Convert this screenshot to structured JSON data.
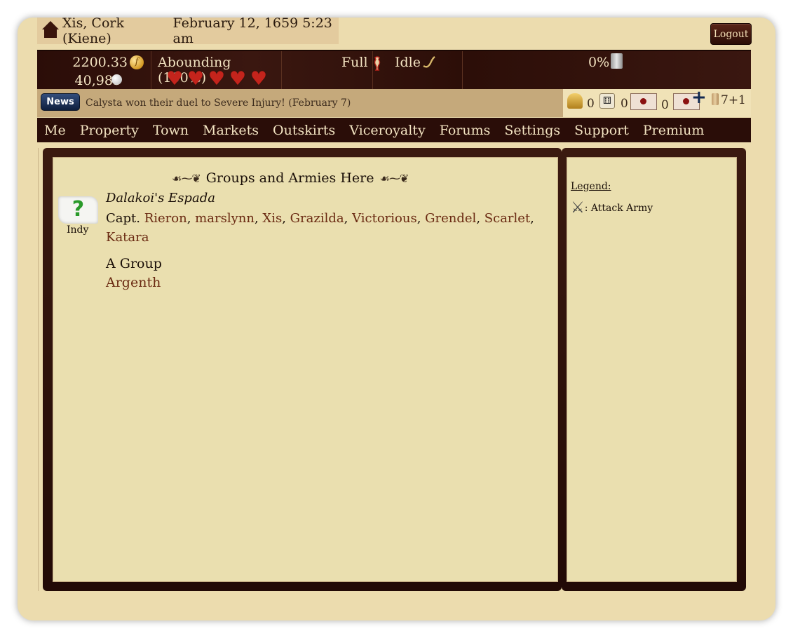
{
  "location": {
    "place": "Xis, Cork (Kiene)",
    "datetime": "February 12, 1659 5:23 am"
  },
  "logout_label": "Logout",
  "status": {
    "gold": "2200.33",
    "pearls": "40,985",
    "mood": "Abounding (100%)",
    "hearts": 5,
    "hunger": "Full",
    "activity": "Idle",
    "drink": "0%"
  },
  "news": {
    "button": "News",
    "text": "Calysta won their duel to Severe Injury! (February 7)"
  },
  "notifications": {
    "alerts": "0",
    "games": "0",
    "messages": "0",
    "scrolls": "7+1"
  },
  "nav": [
    "Me",
    "Property",
    "Town",
    "Markets",
    "Outskirts",
    "Viceroyalty",
    "Forums",
    "Settings",
    "Support",
    "Premium"
  ],
  "main": {
    "heading": "Groups and Armies Here",
    "group1": {
      "name": "Dalakoi's Espada",
      "faction": "Indy",
      "captain_prefix": "Capt.",
      "members": [
        "Rieron",
        "marslynn",
        "Xis",
        "Grazilda",
        "Victorious",
        "Grendel",
        "Scarlet",
        "Katara"
      ]
    },
    "group2": {
      "name": "A Group",
      "members": [
        "Argenth"
      ]
    }
  },
  "legend": {
    "title": "Legend:",
    "attack_army": ": Attack Army"
  },
  "colors": {
    "frame": "#ecdcae",
    "dark_bar": "#2a0d08",
    "panel_bg": "#eadfaf",
    "link": "#6a2a12"
  }
}
